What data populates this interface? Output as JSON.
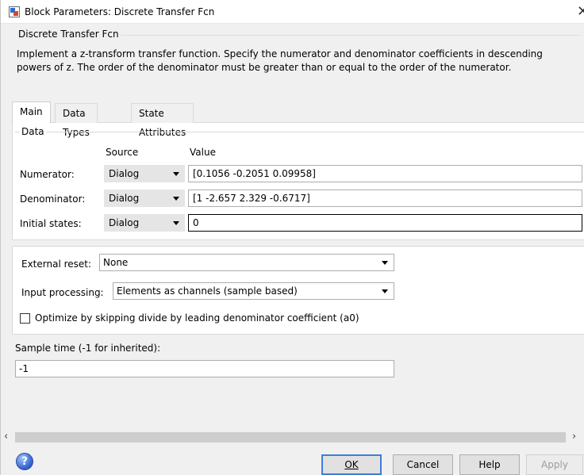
{
  "window": {
    "title": "Block Parameters: Discrete Transfer Fcn"
  },
  "block": {
    "name": "Discrete Transfer Fcn",
    "description": "Implement a z-transform transfer function. Specify the numerator and denominator coefficients in descending powers of z. The order of the denominator must be greater than or equal to the order of the numerator."
  },
  "tabs": [
    {
      "label": "Main",
      "active": true
    },
    {
      "label": "Data Types",
      "active": false
    },
    {
      "label": "State Attributes",
      "active": false
    }
  ],
  "data_group": {
    "label": "Data",
    "source_header": "Source",
    "value_header": "Value",
    "rows": [
      {
        "label": "Numerator:",
        "source": "Dialog",
        "value": "[0.1056 -0.2051 0.09958]"
      },
      {
        "label": "Denominator:",
        "source": "Dialog",
        "value": "[1 -2.657 2.329 -0.6717]"
      },
      {
        "label": "Initial states:",
        "source": "Dialog",
        "value": "0"
      }
    ]
  },
  "options": {
    "external_reset_label": "External reset:",
    "external_reset_value": "None",
    "input_processing_label": "Input processing:",
    "input_processing_value": "Elements as channels (sample based)",
    "optimize_label": "Optimize by skipping divide by leading denominator coefficient (a0)",
    "optimize_checked": false
  },
  "sample_time": {
    "label": "Sample time (-1 for inherited):",
    "value": "-1"
  },
  "buttons": {
    "ok": "OK",
    "cancel": "Cancel",
    "help": "Help",
    "apply": "Apply"
  },
  "icons": {
    "help": "?",
    "scroll_left": "‹",
    "scroll_right": "›",
    "close": "✕"
  }
}
